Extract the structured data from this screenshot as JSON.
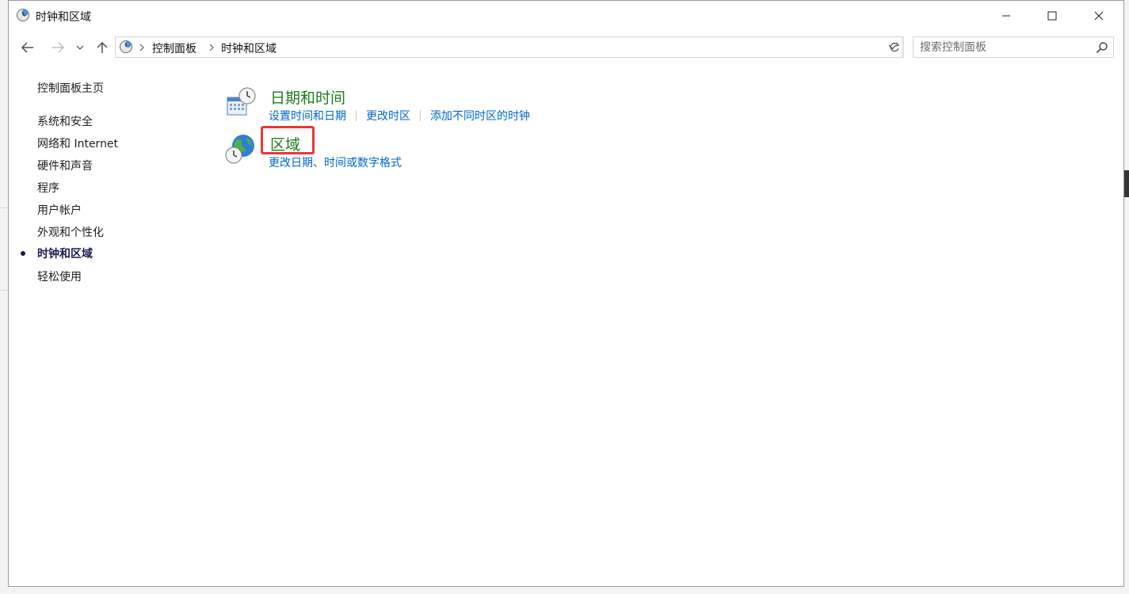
{
  "window": {
    "title": "时钟和区域",
    "controls": {
      "minimize": "minimize",
      "maximize": "maximize",
      "close": "close"
    }
  },
  "address": {
    "breadcrumbs": [
      "控制面板",
      "时钟和区域"
    ]
  },
  "search": {
    "placeholder": "搜索控制面板"
  },
  "sidebar": {
    "home": "控制面板主页",
    "items": [
      {
        "label": "系统和安全"
      },
      {
        "label": "网络和 Internet"
      },
      {
        "label": "硬件和声音"
      },
      {
        "label": "程序"
      },
      {
        "label": "用户帐户"
      },
      {
        "label": "外观和个性化"
      },
      {
        "label": "时钟和区域",
        "active": true
      },
      {
        "label": "轻松使用"
      }
    ]
  },
  "categories": [
    {
      "title": "日期和时间",
      "icon": "calendar-clock-icon",
      "links": [
        "设置时间和日期",
        "更改时区",
        "添加不同时区的时钟"
      ]
    },
    {
      "title": "区域",
      "icon": "globe-clock-icon",
      "links": [
        "更改日期、时间或数字格式"
      ]
    }
  ],
  "colors": {
    "category_title": "#1e7a1e",
    "link": "#0066cc",
    "highlight": "#e53935",
    "active_nav": "#1a1a50"
  }
}
